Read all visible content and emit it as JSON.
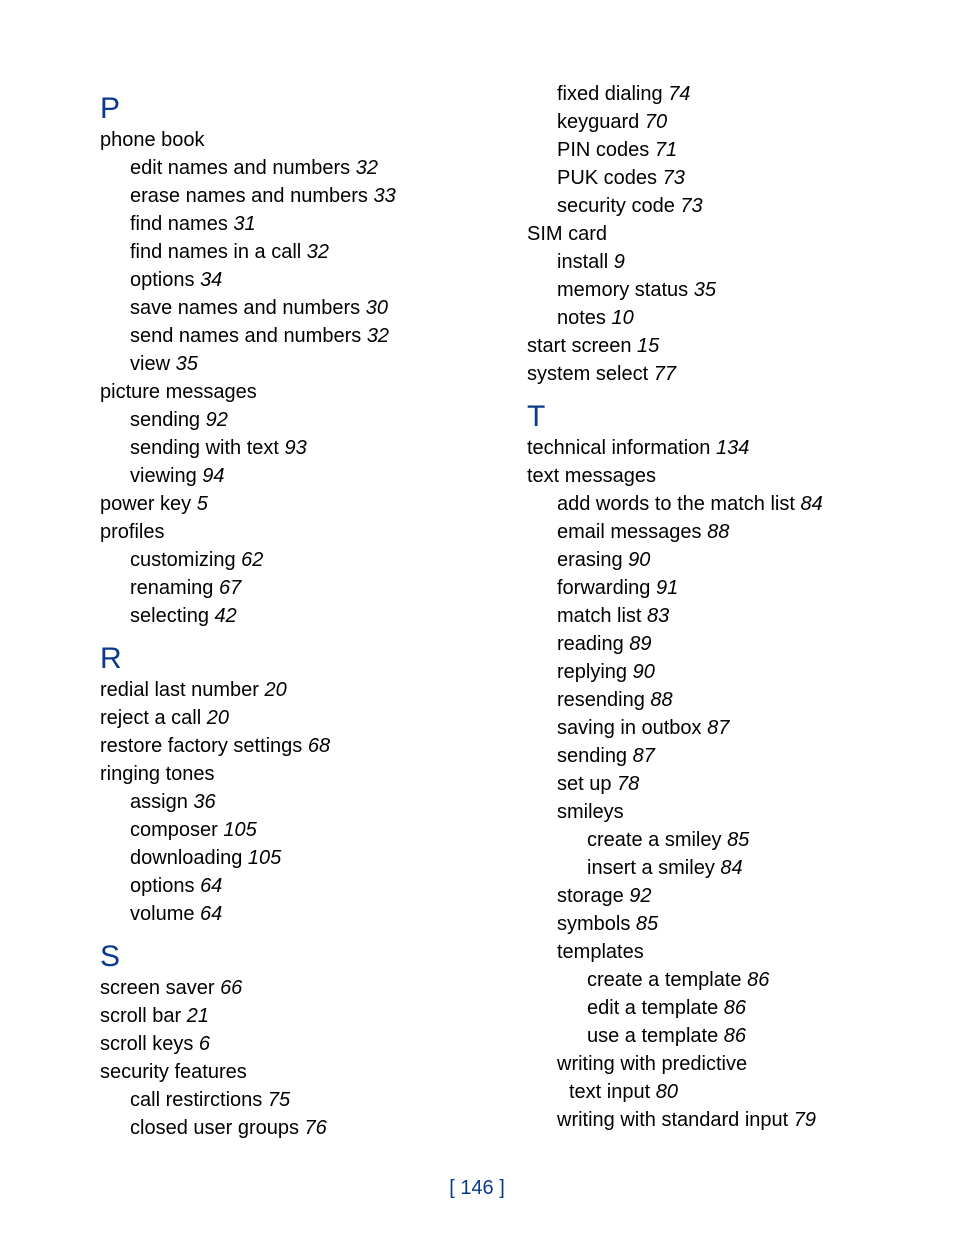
{
  "page_number": "146",
  "columns": [
    [
      {
        "type": "letter",
        "text": "P"
      },
      {
        "type": "entry",
        "level": 0,
        "text": "phone book"
      },
      {
        "type": "entry",
        "level": 1,
        "text": "edit names and numbers",
        "page": "32"
      },
      {
        "type": "entry",
        "level": 1,
        "text": "erase names and numbers",
        "page": "33"
      },
      {
        "type": "entry",
        "level": 1,
        "text": "find names",
        "page": "31"
      },
      {
        "type": "entry",
        "level": 1,
        "text": "find names in a call",
        "page": "32"
      },
      {
        "type": "entry",
        "level": 1,
        "text": "options",
        "page": "34"
      },
      {
        "type": "entry",
        "level": 1,
        "text": "save names and numbers",
        "page": "30"
      },
      {
        "type": "entry",
        "level": 1,
        "text": "send names and numbers",
        "page": "32"
      },
      {
        "type": "entry",
        "level": 1,
        "text": "view",
        "page": "35"
      },
      {
        "type": "entry",
        "level": 0,
        "text": "picture messages"
      },
      {
        "type": "entry",
        "level": 1,
        "text": "sending",
        "page": "92"
      },
      {
        "type": "entry",
        "level": 1,
        "text": "sending with text",
        "page": "93"
      },
      {
        "type": "entry",
        "level": 1,
        "text": "viewing",
        "page": "94"
      },
      {
        "type": "entry",
        "level": 0,
        "text": "power key",
        "page": "5"
      },
      {
        "type": "entry",
        "level": 0,
        "text": "profiles"
      },
      {
        "type": "entry",
        "level": 1,
        "text": "customizing",
        "page": "62"
      },
      {
        "type": "entry",
        "level": 1,
        "text": "renaming",
        "page": "67"
      },
      {
        "type": "entry",
        "level": 1,
        "text": "selecting",
        "page": "42"
      },
      {
        "type": "letter",
        "text": "R"
      },
      {
        "type": "entry",
        "level": 0,
        "text": "redial last number",
        "page": "20"
      },
      {
        "type": "entry",
        "level": 0,
        "text": "reject a call",
        "page": "20"
      },
      {
        "type": "entry",
        "level": 0,
        "text": "restore factory settings",
        "page": "68"
      },
      {
        "type": "entry",
        "level": 0,
        "text": "ringing tones"
      },
      {
        "type": "entry",
        "level": 1,
        "text": "assign",
        "page": "36"
      },
      {
        "type": "entry",
        "level": 1,
        "text": "composer",
        "page": "105"
      },
      {
        "type": "entry",
        "level": 1,
        "text": "downloading",
        "page": "105"
      },
      {
        "type": "entry",
        "level": 1,
        "text": "options",
        "page": "64"
      },
      {
        "type": "entry",
        "level": 1,
        "text": "volume",
        "page": "64"
      },
      {
        "type": "letter",
        "text": "S"
      },
      {
        "type": "entry",
        "level": 0,
        "text": "screen saver",
        "page": "66"
      },
      {
        "type": "entry",
        "level": 0,
        "text": "scroll bar",
        "page": "21"
      },
      {
        "type": "entry",
        "level": 0,
        "text": "scroll keys",
        "page": "6"
      },
      {
        "type": "entry",
        "level": 0,
        "text": "security features"
      },
      {
        "type": "entry",
        "level": 1,
        "text": "call restirctions",
        "page": "75"
      },
      {
        "type": "entry",
        "level": 1,
        "text": "closed user groups",
        "page": "76"
      }
    ],
    [
      {
        "type": "entry",
        "level": 1,
        "text": "fixed dialing",
        "page": "74"
      },
      {
        "type": "entry",
        "level": 1,
        "text": "keyguard",
        "page": "70"
      },
      {
        "type": "entry",
        "level": 1,
        "text": "PIN codes",
        "page": "71"
      },
      {
        "type": "entry",
        "level": 1,
        "text": "PUK codes",
        "page": "73"
      },
      {
        "type": "entry",
        "level": 1,
        "text": "security code",
        "page": "73"
      },
      {
        "type": "entry",
        "level": 0,
        "text": "SIM card"
      },
      {
        "type": "entry",
        "level": 1,
        "text": "install",
        "page": "9"
      },
      {
        "type": "entry",
        "level": 1,
        "text": "memory status",
        "page": "35"
      },
      {
        "type": "entry",
        "level": 1,
        "text": "notes",
        "page": "10"
      },
      {
        "type": "entry",
        "level": 0,
        "text": "start screen",
        "page": "15"
      },
      {
        "type": "entry",
        "level": 0,
        "text": "system select",
        "page": "77"
      },
      {
        "type": "letter",
        "text": "T"
      },
      {
        "type": "entry",
        "level": 0,
        "text": "technical information",
        "page": "134"
      },
      {
        "type": "entry",
        "level": 0,
        "text": "text messages"
      },
      {
        "type": "entry",
        "level": 1,
        "text": "add words to the match list",
        "page": "84"
      },
      {
        "type": "entry",
        "level": 1,
        "text": "email messages",
        "page": "88"
      },
      {
        "type": "entry",
        "level": 1,
        "text": "erasing",
        "page": "90"
      },
      {
        "type": "entry",
        "level": 1,
        "text": "forwarding",
        "page": "91"
      },
      {
        "type": "entry",
        "level": 1,
        "text": "match list",
        "page": "83"
      },
      {
        "type": "entry",
        "level": 1,
        "text": "reading",
        "page": "89"
      },
      {
        "type": "entry",
        "level": 1,
        "text": "replying",
        "page": "90"
      },
      {
        "type": "entry",
        "level": 1,
        "text": "resending",
        "page": "88"
      },
      {
        "type": "entry",
        "level": 1,
        "text": "saving in outbox",
        "page": "87"
      },
      {
        "type": "entry",
        "level": 1,
        "text": "sending",
        "page": "87"
      },
      {
        "type": "entry",
        "level": 1,
        "text": "set up",
        "page": "78"
      },
      {
        "type": "entry",
        "level": 1,
        "text": "smileys"
      },
      {
        "type": "entry",
        "level": 2,
        "text": "create a smiley",
        "page": "85"
      },
      {
        "type": "entry",
        "level": 2,
        "text": "insert a smiley",
        "page": "84"
      },
      {
        "type": "entry",
        "level": 1,
        "text": "storage",
        "page": "92"
      },
      {
        "type": "entry",
        "level": 1,
        "text": "symbols",
        "page": "85"
      },
      {
        "type": "entry",
        "level": 1,
        "text": "templates"
      },
      {
        "type": "entry",
        "level": 2,
        "text": "create a template",
        "page": "86"
      },
      {
        "type": "entry",
        "level": 2,
        "text": "edit a template",
        "page": "86"
      },
      {
        "type": "entry",
        "level": 2,
        "text": "use a template",
        "page": "86"
      },
      {
        "type": "entry",
        "level": 1,
        "text": "writing with predictive"
      },
      {
        "type": "entry",
        "level": "continue",
        "text": "text input",
        "page": "80"
      },
      {
        "type": "entry",
        "level": 1,
        "text": "writing with standard input",
        "page": "79"
      }
    ]
  ]
}
